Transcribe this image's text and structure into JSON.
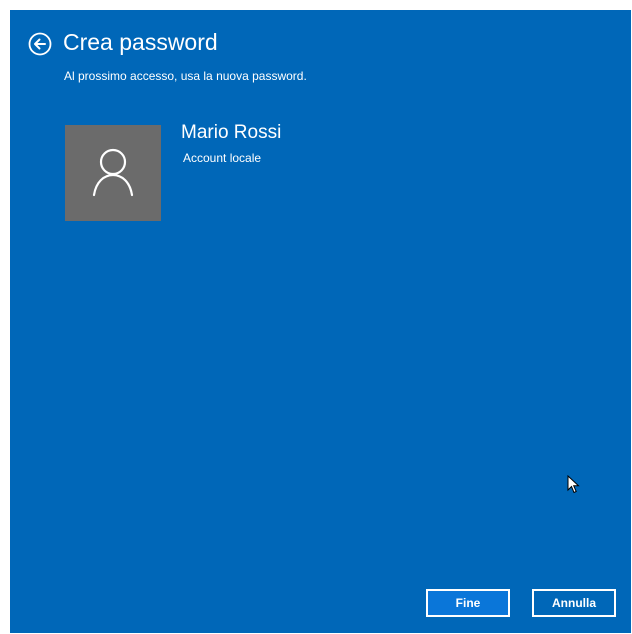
{
  "header": {
    "back_icon": "back-arrow-circle-icon",
    "title": "Crea password",
    "subtitle": "Al prossimo accesso, usa la nuova password."
  },
  "user": {
    "avatar_icon": "user-silhouette-icon",
    "name": "Mario Rossi",
    "account_type": "Account locale"
  },
  "footer": {
    "finish_label": "Fine",
    "cancel_label": "Annulla"
  },
  "colors": {
    "background": "#0067b8",
    "avatar_bg": "#6b6b6b",
    "text": "#ffffff"
  }
}
